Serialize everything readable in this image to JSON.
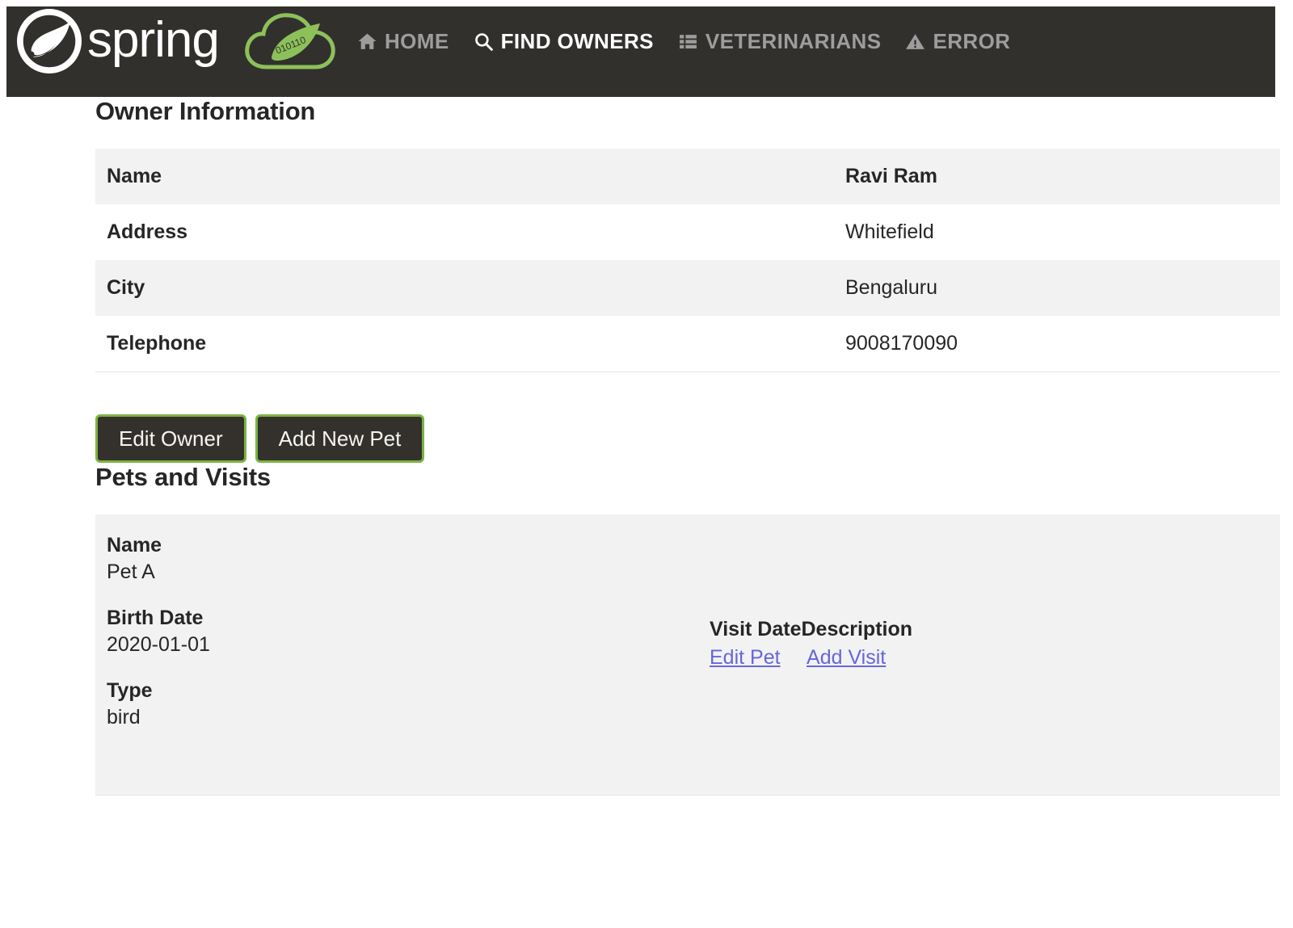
{
  "brand": {
    "name": "spring",
    "logo_icon": "spring-leaf-logo",
    "cloud_icon": "spring-cloud-leaf-icon",
    "cloud_binary": "010110"
  },
  "nav": {
    "items": [
      {
        "label": "HOME",
        "icon": "home-icon",
        "active": false
      },
      {
        "label": "FIND OWNERS",
        "icon": "search-icon",
        "active": true
      },
      {
        "label": "VETERINARIANS",
        "icon": "list-icon",
        "active": false
      },
      {
        "label": "ERROR",
        "icon": "warning-triangle-icon",
        "active": false
      }
    ]
  },
  "owner_section": {
    "title": "Owner Information",
    "rows": [
      {
        "label": "Name",
        "value": "Ravi Ram",
        "bold": true
      },
      {
        "label": "Address",
        "value": "Whitefield",
        "bold": false
      },
      {
        "label": "City",
        "value": "Bengaluru",
        "bold": false
      },
      {
        "label": "Telephone",
        "value": "9008170090",
        "bold": false
      }
    ]
  },
  "actions": {
    "edit_owner": "Edit Owner",
    "add_new_pet": "Add New Pet"
  },
  "pets_section": {
    "title": "Pets and Visits",
    "pet": {
      "name_label": "Name",
      "name_value": "Pet A",
      "birth_label": "Birth Date",
      "birth_value": "2020-01-01",
      "type_label": "Type",
      "type_value": "bird"
    },
    "visits": {
      "headers": [
        "Visit Date",
        "Description"
      ],
      "rows": [],
      "edit_pet_link": "Edit Pet",
      "add_visit_link": "Add Visit"
    }
  },
  "colors": {
    "header_bg": "#32302D",
    "accent_green": "#7CB342",
    "row_stripe": "#F2F2F2",
    "link": "#6666DD",
    "text": "#262626",
    "nav_inactive": "#9D9D9D"
  }
}
